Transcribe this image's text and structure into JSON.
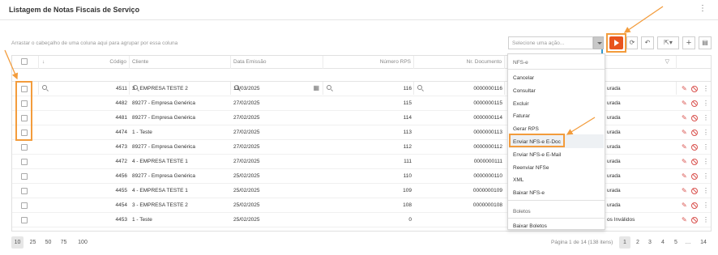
{
  "header": {
    "title": "Listagem de Notas Fiscais de Serviço",
    "menu_icon": "kebab-vertical-icon"
  },
  "toolbar": {
    "group_hint": "Arrastar o cabeçalho de uma coluna aqui para agrupar por essa coluna",
    "action_placeholder": "Selecione uma ação..."
  },
  "columns": {
    "sort_arrow": "↓",
    "codigo": "Código",
    "cliente": "Cliente",
    "data_emissao": "Data Emissão",
    "numero_rps": "Número RPS",
    "nr_documento": "Nr. Documento"
  },
  "rows": [
    {
      "codigo": "4511",
      "cliente": "3 - EMPRESA TESTE 2",
      "data": "13/03/2025",
      "rps": "116",
      "doc": "0000000116",
      "status": "urada"
    },
    {
      "codigo": "4482",
      "cliente": "89277 - Empresa Genérica",
      "data": "27/02/2025",
      "rps": "115",
      "doc": "0000000115",
      "status": "urada"
    },
    {
      "codigo": "4481",
      "cliente": "89277 - Empresa Genérica",
      "data": "27/02/2025",
      "rps": "114",
      "doc": "0000000114",
      "status": "urada"
    },
    {
      "codigo": "4474",
      "cliente": "1 - Teste",
      "data": "27/02/2025",
      "rps": "113",
      "doc": "0000000113",
      "status": "urada"
    },
    {
      "codigo": "4473",
      "cliente": "89277 - Empresa Genérica",
      "data": "27/02/2025",
      "rps": "112",
      "doc": "0000000112",
      "status": "urada"
    },
    {
      "codigo": "4472",
      "cliente": "4 - EMPRESA TESTE 1",
      "data": "27/02/2025",
      "rps": "111",
      "doc": "0000000111",
      "status": "urada"
    },
    {
      "codigo": "4456",
      "cliente": "89277 - Empresa Genérica",
      "data": "25/02/2025",
      "rps": "110",
      "doc": "0000000110",
      "status": "urada"
    },
    {
      "codigo": "4455",
      "cliente": "4 - EMPRESA TESTE 1",
      "data": "25/02/2025",
      "rps": "109",
      "doc": "0000000109",
      "status": "urada"
    },
    {
      "codigo": "4454",
      "cliente": "3 - EMPRESA TESTE 2",
      "data": "25/02/2025",
      "rps": "108",
      "doc": "0000000108",
      "status": "urada"
    },
    {
      "codigo": "4453",
      "cliente": "1 - Teste",
      "data": "25/02/2025",
      "rps": "0",
      "doc": "",
      "status": "os Inválidos"
    }
  ],
  "dropdown": {
    "group1": "NFS-e",
    "items1": [
      "Cancelar",
      "Consultar",
      "Excluir",
      "Faturar",
      "Gerar RPS",
      "Enviar NFS-e E-Doc",
      "Enviar NFS-e E-Mail",
      "Reenviar NFSe",
      "XML",
      "Baixar NFS-e"
    ],
    "group2": "Boletos",
    "items2": [
      "Baixar Boletos"
    ]
  },
  "pager": {
    "sizes": [
      "10",
      "25",
      "50",
      "75",
      "100"
    ],
    "info": "Página 1 de 14 (138 itens)",
    "pages": [
      "1",
      "2",
      "3",
      "4",
      "5",
      "…",
      "14"
    ]
  },
  "colors": {
    "accent": "#e8541e",
    "highlight": "#f39c3c",
    "danger": "#d9534f",
    "link": "#3399cc"
  }
}
